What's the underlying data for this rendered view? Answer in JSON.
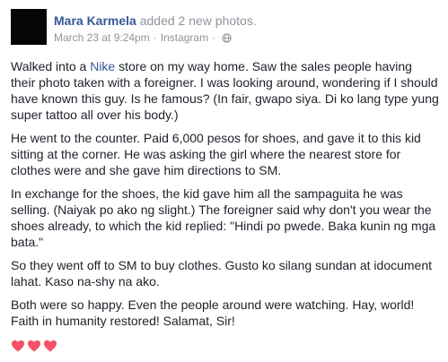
{
  "post": {
    "author": "Mara Karmela",
    "action": "added 2 new photos.",
    "timestamp": "March 23 at 9:24pm",
    "separator": "·",
    "source": "Instagram",
    "privacy_icon": "globe-icon",
    "paragraphs": {
      "p1": {
        "before": "Walked into a ",
        "link": "Nike",
        "after": " store on my way home. Saw the sales people having their photo taken with a foreigner. I was looking around, wondering if I should have known this guy. Is he famous? (In fair, gwapo siya. Di ko lang type yung super tattoo all over his body.)"
      },
      "p2": "He went to the counter. Paid 6,000 pesos for shoes, and gave it to this kid sitting at the corner. He was asking the girl where the nearest store for clothes were and she gave him directions to SM.",
      "p3": "In exchange for the shoes, the kid gave him all the sampaguita he was selling. (Naiyak po ako ng slight.) The foreigner said why don't you wear the shoes already, to which the kid replied: \"Hindi po pwede. Baka kunin ng mga bata.\"",
      "p4": "So they went off to SM to buy clothes. Gusto ko silang sundan at idocument lahat. Kaso na-shy na ako.",
      "p5": "Both were so happy. Even the people around were watching. Hay, world! Faith in humanity restored! Salamat, Sir!"
    },
    "hearts": [
      "heart-icon",
      "heart-icon",
      "heart-icon"
    ],
    "colors": {
      "link": "#365899",
      "meta": "#90949c",
      "text": "#1d2129",
      "heart": "#f25268"
    }
  }
}
